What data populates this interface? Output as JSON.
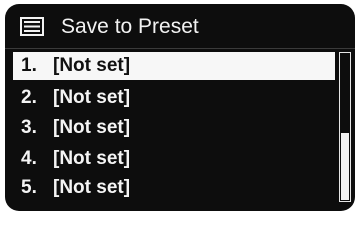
{
  "header": {
    "title": "Save to Preset",
    "icon": "preset-list-icon"
  },
  "presets": [
    {
      "number": "1.",
      "label": "[Not set]",
      "selected": true
    },
    {
      "number": "2.",
      "label": "[Not set]",
      "selected": false
    },
    {
      "number": "3.",
      "label": "[Not set]",
      "selected": false
    },
    {
      "number": "4.",
      "label": "[Not set]",
      "selected": false
    },
    {
      "number": "5.",
      "label": "[Not set]",
      "selected": false
    }
  ],
  "scroll": {
    "position_fraction": 0.0,
    "visible_fraction": 0.5
  },
  "colors": {
    "screen_background": "#0d0d0d",
    "text": "#f4f4f4",
    "highlight_background": "#f7f7f7",
    "highlight_text": "#111111"
  }
}
